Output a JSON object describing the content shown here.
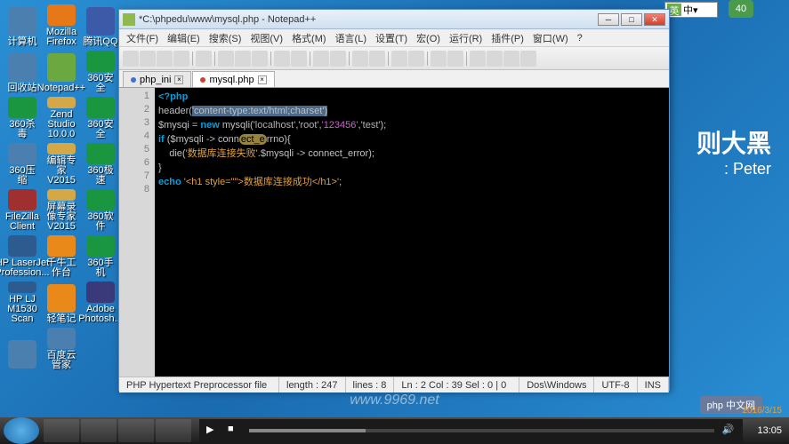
{
  "desktop": {
    "bigtext": "则大黑",
    "subtext": ": Peter",
    "icons": [
      {
        "label": "计算机",
        "c": "c1"
      },
      {
        "label": "Mozilla Firefox",
        "c": "c2"
      },
      {
        "label": "腾讯QQ",
        "c": "c3"
      },
      {
        "label": "回收站",
        "c": "c1"
      },
      {
        "label": "Notepad++",
        "c": "c4"
      },
      {
        "label": "360安全",
        "c": "c5"
      },
      {
        "label": "360杀毒",
        "c": "c5"
      },
      {
        "label": "Zend Studio 10.0.0",
        "c": "c6"
      },
      {
        "label": "360安全",
        "c": "c5"
      },
      {
        "label": "360压缩",
        "c": "c1"
      },
      {
        "label": "编辑专家 V2015",
        "c": "c6"
      },
      {
        "label": "360极速",
        "c": "c5"
      },
      {
        "label": "FileZilla Client",
        "c": "c7"
      },
      {
        "label": "屏幕录像专家 V2015",
        "c": "c6"
      },
      {
        "label": "360软件",
        "c": "c5"
      },
      {
        "label": "HP LaserJet Profession...",
        "c": "c8"
      },
      {
        "label": "千牛工作台",
        "c": "c9"
      },
      {
        "label": "360手机",
        "c": "c5"
      },
      {
        "label": "HP LJ M1530 Scan",
        "c": "c8"
      },
      {
        "label": "轻笔记",
        "c": "c9"
      },
      {
        "label": "Adobe Photosh...",
        "c": "c11"
      },
      {
        "label": "",
        "c": "c1"
      },
      {
        "label": "百度云管家",
        "c": "c1"
      }
    ]
  },
  "ime": {
    "lang": "英",
    "mode": "中"
  },
  "badge": "40",
  "npp": {
    "title": "*C:\\phpedu\\www\\mysql.php - Notepad++",
    "menu": [
      "文件(F)",
      "编辑(E)",
      "搜索(S)",
      "视图(V)",
      "格式(M)",
      "语言(L)",
      "设置(T)",
      "宏(O)",
      "运行(R)",
      "插件(P)",
      "窗口(W)",
      "?"
    ],
    "tabs": [
      {
        "label": "php_ini",
        "active": false,
        "dirty": false
      },
      {
        "label": "mysql.php",
        "active": true,
        "dirty": true
      }
    ],
    "code": {
      "lines": [
        "1",
        "2",
        "3",
        "4",
        "5",
        "6",
        "7",
        "8"
      ],
      "l1a": "<?php",
      "l2a": "header",
      "l2b": "(",
      "l2c": "'content-type:text/html;charset'",
      "l2d": ")",
      "l3a": "$mysqi = ",
      "l3b": "new",
      "l3c": " mysqli(",
      "l3d": "'localhost'",
      "l3e": ",",
      "l3f": "'root'",
      "l3g": ",",
      "l3h": "'123456'",
      "l3i": ",",
      "l3j": "'test'",
      "l3k": ");",
      "l4a": "if",
      "l4b": " (",
      "l4c": "$mysqli",
      "l4d": " -> conn",
      "l4e": "ect_e",
      "l4f": "rrno){",
      "l5a": "    die(",
      "l5b": "'数据库连接失败'",
      "l5c": ".",
      "l5d": "$mysqli",
      "l5e": " -> connect_error);",
      "l6a": "}",
      "l7a": "echo",
      "l7b": " ",
      "l7c": "'<h1 style=\"\">数据库连接成功</h1>'",
      "l7d": ";"
    },
    "status": {
      "type": "PHP Hypertext Preprocessor file",
      "length": "length : 247",
      "lines": "lines : 8",
      "pos": "Ln : 2    Col : 39    Sel : 0 | 0",
      "eol": "Dos\\Windows",
      "enc": "UTF-8",
      "mode": "INS"
    }
  },
  "watermark": "www.9969.net",
  "phplogo": "php 中文网",
  "taskbar": {
    "time": "13:05",
    "date": "2016/3/15"
  }
}
